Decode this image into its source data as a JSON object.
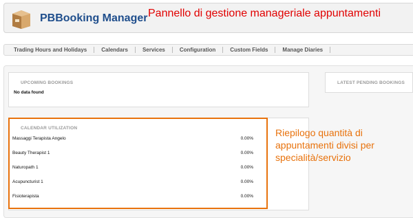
{
  "header": {
    "app_title": "PBBooking Manager",
    "annotation": "Pannello di gestione manageriale appuntamenti",
    "logo_icon": "box-icon"
  },
  "nav": {
    "items": [
      {
        "label": "Trading Hours and Holidays"
      },
      {
        "label": "Calendars"
      },
      {
        "label": "Services"
      },
      {
        "label": "Configuration"
      },
      {
        "label": "Custom Fields"
      },
      {
        "label": "Manage Diaries"
      }
    ]
  },
  "upcoming": {
    "title": "UPCOMING BOOKINGS",
    "empty_text": "No data found"
  },
  "pending": {
    "title": "LATEST PENDING BOOKINGS"
  },
  "utilization": {
    "title": "CALENDAR UTILIZATION",
    "rows": [
      {
        "name": "Massaggi Terapista Angelo",
        "value": "0.00%"
      },
      {
        "name": "Beauty Therapist 1",
        "value": "0.00%"
      },
      {
        "name": "Naturopath 1",
        "value": "0.00%"
      },
      {
        "name": "Acupuncturist 1",
        "value": "0.00%"
      },
      {
        "name": "Fisioterapista",
        "value": "0.00%"
      }
    ]
  },
  "side_annotation": "Riepilogo quantità di appuntamenti divisi per specialità/servizio",
  "colors": {
    "title_blue": "#1f4e8c",
    "annotation_red": "#e10000",
    "annotation_orange": "#e8720c"
  }
}
